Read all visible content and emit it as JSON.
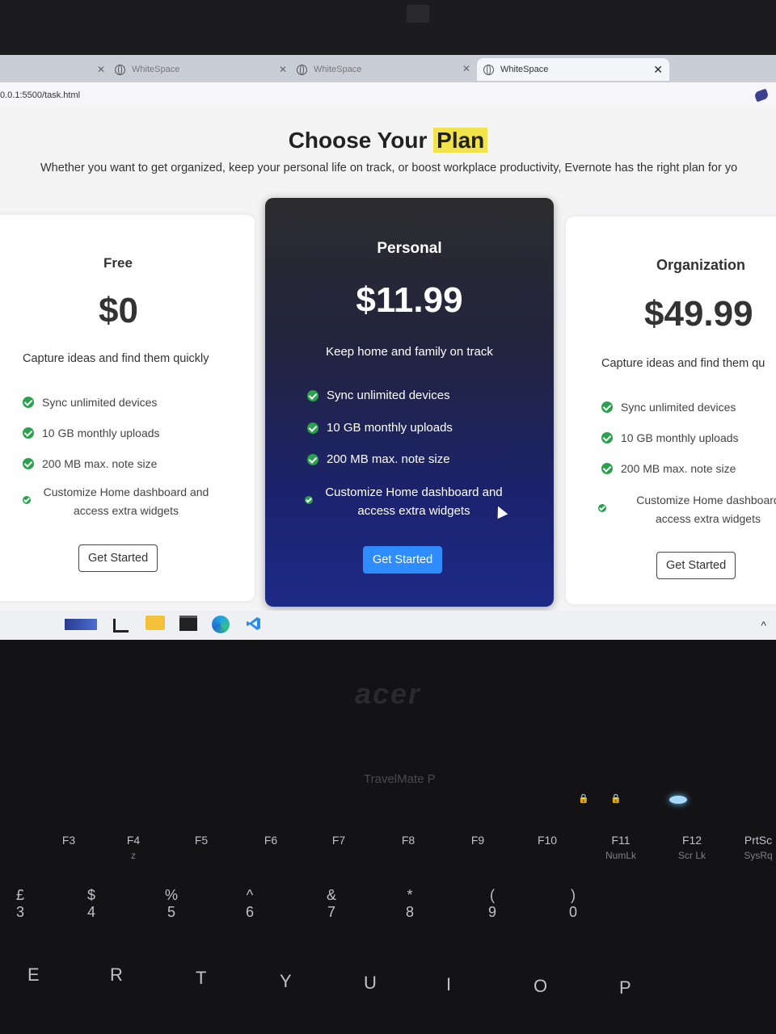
{
  "browser": {
    "tabs": [
      {
        "title": "WhiteSpace",
        "active": false
      },
      {
        "title": "WhiteSpace",
        "active": false
      },
      {
        "title": "WhiteSpace",
        "active": true
      }
    ],
    "url": "0.0.1:5500/task.html"
  },
  "page": {
    "title": "Choose Your",
    "title_highlight": "Plan",
    "subtitle": "Whether you want to get organized, keep your personal life on track, or boost workplace productivity, Evernote has the right plan for yo"
  },
  "plans": [
    {
      "name": "Free",
      "price": "$0",
      "description": "Capture ideas and find them quickly",
      "features": [
        "Sync unlimited devices",
        "10 GB monthly uploads",
        "200 MB max. note size"
      ],
      "feature_multiline": [
        "Customize Home dashboard and",
        "access extra widgets"
      ],
      "button": "Get Started"
    },
    {
      "name": "Personal",
      "price": "$11.99",
      "description": "Keep home and family on track",
      "features": [
        "Sync unlimited devices",
        "10 GB monthly uploads",
        "200 MB max. note size"
      ],
      "feature_multiline": [
        "Customize Home dashboard and",
        "access extra widgets"
      ],
      "button": "Get Started"
    },
    {
      "name": "Organization",
      "price": "$49.99",
      "description": "Capture ideas and find them qu",
      "features": [
        "Sync unlimited devices",
        "10 GB monthly uploads",
        "200 MB max. note size"
      ],
      "feature_multiline": [
        "Customize Home dashboard",
        "access extra widgets"
      ],
      "button": "Get Started"
    }
  ],
  "taskbar": {
    "icons": [
      "widgets-icon",
      "task-view-icon",
      "file-explorer-icon",
      "terminal-icon",
      "edge-icon",
      "vscode-icon"
    ],
    "chevron": "^"
  },
  "laptop": {
    "brand": "acer",
    "model": "TravelMate P",
    "fkeys": [
      {
        "label": "F3",
        "sub": ""
      },
      {
        "label": "F4",
        "sub": "z"
      },
      {
        "label": "F5",
        "sub": ""
      },
      {
        "label": "F6",
        "sub": ""
      },
      {
        "label": "F7",
        "sub": ""
      },
      {
        "label": "F8",
        "sub": ""
      },
      {
        "label": "F9",
        "sub": ""
      },
      {
        "label": "F10",
        "sub": ""
      },
      {
        "label": "F11",
        "sub": "NumLk"
      },
      {
        "label": "F12",
        "sub": "Scr Lk"
      },
      {
        "label": "PrtSc",
        "sub": "SysRq"
      }
    ],
    "number_keys": [
      "3",
      "4",
      "5",
      "6",
      "7",
      "8",
      "9",
      "0"
    ],
    "number_symbols": [
      "£",
      "$",
      "%",
      "^",
      "&",
      "*",
      "(",
      ")"
    ],
    "letter_keys": [
      "E",
      "R",
      "T",
      "Y",
      "U",
      "I",
      "O",
      "P"
    ]
  }
}
